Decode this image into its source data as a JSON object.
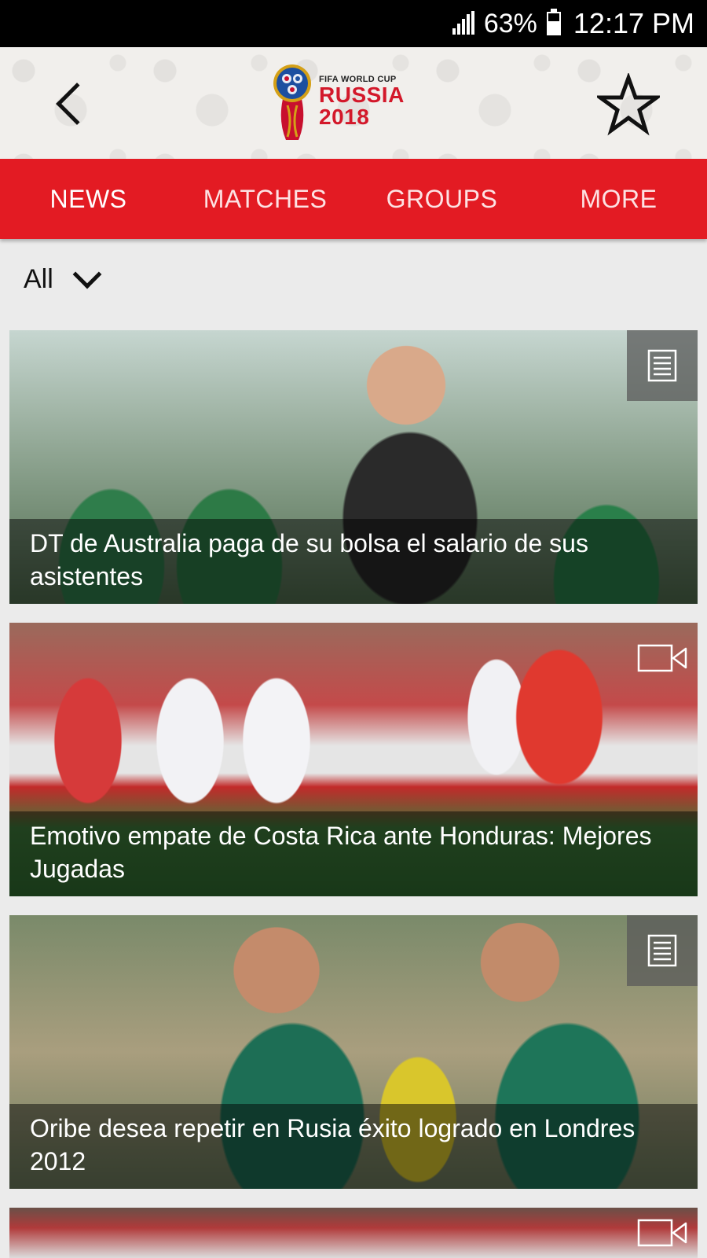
{
  "status_bar": {
    "battery_percent": "63%",
    "time": "12:17 PM"
  },
  "header": {
    "logo_small": "FIFA WORLD CUP",
    "logo_line1": "RUSSIA",
    "logo_line2": "2018",
    "back_icon": "chevron-left-icon",
    "favorite_icon": "star-outline-icon"
  },
  "tabs": [
    {
      "label": "NEWS",
      "active": true
    },
    {
      "label": "MATCHES",
      "active": false
    },
    {
      "label": "GROUPS",
      "active": false
    },
    {
      "label": "MORE",
      "active": false
    }
  ],
  "filter": {
    "selected": "All"
  },
  "cards": [
    {
      "title": "DT de Australia paga de su bolsa el salario de sus asistentes",
      "type": "article"
    },
    {
      "title": "Emotivo empate de Costa Rica ante Honduras: Mejores Jugadas",
      "type": "video"
    },
    {
      "title": "Oribe desea repetir en Rusia éxito logrado en Londres 2012",
      "type": "article"
    },
    {
      "title": "",
      "type": "video"
    }
  ],
  "colors": {
    "tab_bar": "#e31b23",
    "logo_red": "#d3182a"
  }
}
